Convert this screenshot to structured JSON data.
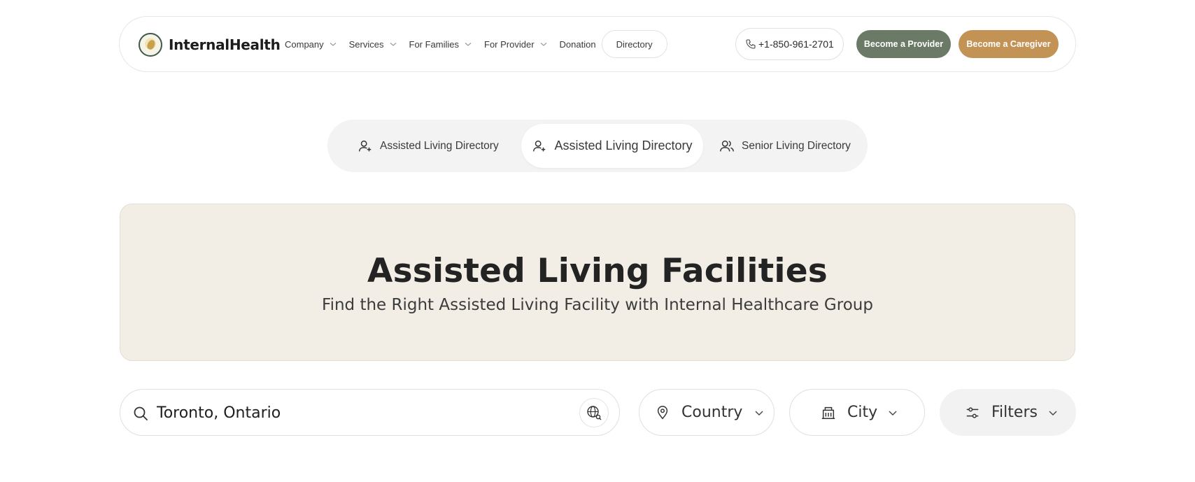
{
  "header": {
    "logo_text": "InternalHealth",
    "nav": [
      {
        "label": "Company",
        "has_dropdown": true
      },
      {
        "label": "Services",
        "has_dropdown": true
      },
      {
        "label": "For Families",
        "has_dropdown": true
      },
      {
        "label": "For Provider",
        "has_dropdown": true
      },
      {
        "label": "Donation",
        "has_dropdown": false
      }
    ],
    "directory_label": "Directory",
    "phone": "+1-850-961-2701",
    "become_provider": "Become a Provider",
    "become_caregiver": "Become a Caregiver"
  },
  "tabs": [
    {
      "label": "Assisted Living Directory",
      "active": false,
      "icon": "user-plus-icon"
    },
    {
      "label": "Assisted Living Directory",
      "active": true,
      "icon": "user-plus-icon"
    },
    {
      "label": "Senior Living Directory",
      "active": false,
      "icon": "users-icon"
    }
  ],
  "hero": {
    "title": "Assisted Living Facilities",
    "subtitle": "Find the Right Assisted Living Facility with Internal Healthcare Group"
  },
  "search": {
    "value": "Toronto, Ontario"
  },
  "filters": {
    "country_label": "Country",
    "city_label": "City",
    "filters_label": "Filters"
  },
  "colors": {
    "provider_button": "#6b7a66",
    "caregiver_button": "#c39355",
    "hero_background": "#f2eee6"
  }
}
